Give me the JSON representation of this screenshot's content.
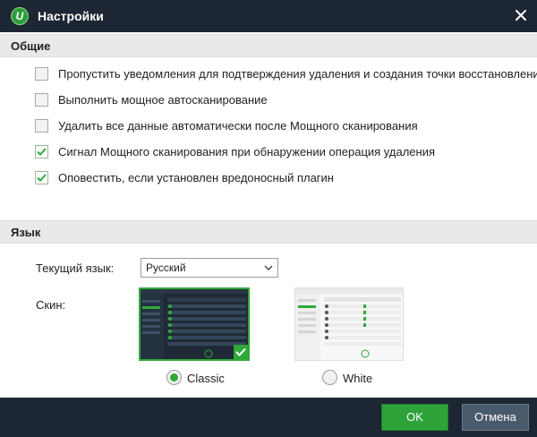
{
  "window": {
    "title": "Настройки",
    "logo_letter": "U"
  },
  "general": {
    "header": "Общие",
    "options": [
      {
        "label": "Пропустить уведомления для подтверждения удаления и создания точки восстановления",
        "checked": false
      },
      {
        "label": "Выполнить мощное автосканирование",
        "checked": false
      },
      {
        "label": "Удалить все данные автоматически после Мощного сканирования",
        "checked": false
      },
      {
        "label": "Сигнал Мощного сканирования при обнаружении операция удаления",
        "checked": true
      },
      {
        "label": "Оповестить, если установлен вредоносный плагин",
        "checked": true
      }
    ]
  },
  "language": {
    "header": "Язык",
    "current_label": "Текущий язык:",
    "current_value": "Русский",
    "skin_label": "Скин:",
    "skins": [
      {
        "label": "Classic",
        "selected": true
      },
      {
        "label": "White",
        "selected": false
      }
    ]
  },
  "footer": {
    "ok_label": "OK",
    "cancel_label": "Отмена"
  },
  "colors": {
    "accent": "#2faa3a",
    "titlebar": "#1d2633"
  },
  "icons": {
    "close": "close-icon",
    "dropdown": "chevron-down-icon",
    "check": "checkmark-icon"
  }
}
